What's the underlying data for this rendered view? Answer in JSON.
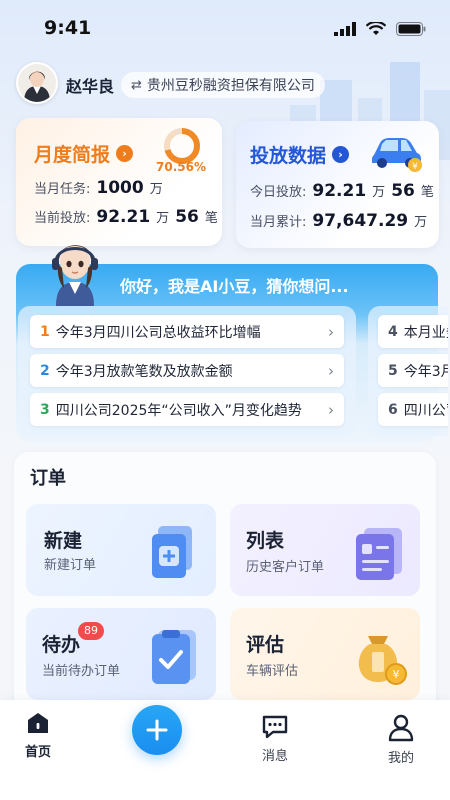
{
  "status_bar": {
    "time": "9:41"
  },
  "user": {
    "name": "赵华良",
    "company": "贵州豆秒融资担保有限公司",
    "switch_icon": "swap-icon"
  },
  "month_card": {
    "title": "月度简报",
    "progress_text": "70.56%",
    "progress": 0.7056,
    "task_label": "当月任务:",
    "task_value": "1000",
    "task_unit": "万",
    "invest_label": "当前投放:",
    "invest_value": "92.21",
    "invest_unit": "万",
    "invest_count": "56",
    "invest_count_unit": "笔",
    "accent": "#f07d1c"
  },
  "invest_card": {
    "title": "投放数据",
    "today_label": "今日投放:",
    "today_value": "92.21",
    "today_unit": "万",
    "today_count": "56",
    "today_count_unit": "笔",
    "total_label": "当月累计:",
    "total_value": "97,647.29",
    "total_unit": "万",
    "accent": "#2457d6"
  },
  "ai": {
    "greeting": "你好，我是AI小豆，猜你想问...",
    "questions": [
      {
        "num": "1",
        "text": "今年3月四川公司总收益环比增幅",
        "color": "#f07d1c"
      },
      {
        "num": "2",
        "text": "今年3月放款笔数及放款金额",
        "color": "#2a8ae6"
      },
      {
        "num": "3",
        "text": "四川公司2025年“公司收入”月变化趋势",
        "color": "#2aaa5a"
      }
    ],
    "questions_more": [
      {
        "num": "4",
        "text": "本月业务"
      },
      {
        "num": "5",
        "text": "今年3月"
      },
      {
        "num": "6",
        "text": "四川公司"
      }
    ]
  },
  "orders": {
    "heading": "订单",
    "tiles": [
      {
        "title": "新建",
        "sub": "新建订单"
      },
      {
        "title": "列表",
        "sub": "历史客户订单"
      },
      {
        "title": "待办",
        "sub": "当前待办订单",
        "badge": "89"
      },
      {
        "title": "评估",
        "sub": "车辆评估"
      }
    ]
  },
  "nav": {
    "home": "首页",
    "messages": "消息",
    "mine": "我的"
  }
}
